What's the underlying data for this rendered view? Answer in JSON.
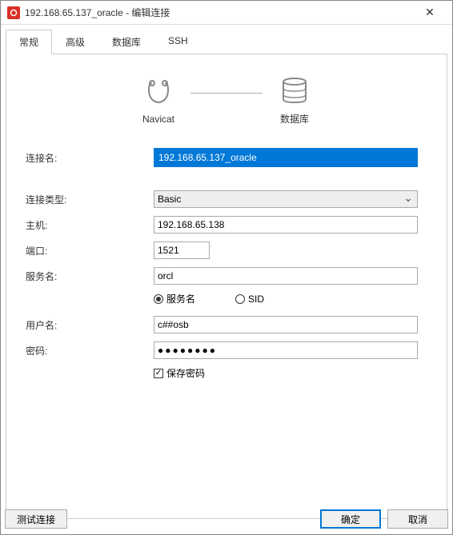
{
  "window": {
    "title": "192.168.65.137_oracle - 编辑连接"
  },
  "tabs": [
    {
      "label": "常规",
      "active": true
    },
    {
      "label": "高级",
      "active": false
    },
    {
      "label": "数据库",
      "active": false
    },
    {
      "label": "SSH",
      "active": false
    }
  ],
  "diagram": {
    "left_label": "Navicat",
    "right_label": "数据库"
  },
  "form": {
    "connection_name_label": "连接名:",
    "connection_name_value": "192.168.65.137_oracle",
    "connection_type_label": "连接类型:",
    "connection_type_value": "Basic",
    "host_label": "主机:",
    "host_value": "192.168.65.138",
    "port_label": "端口:",
    "port_value": "1521",
    "service_name_label": "服务名:",
    "service_name_value": "orcl",
    "radio_service": "服务名",
    "radio_sid": "SID",
    "username_label": "用户名:",
    "username_value": "c##osb",
    "password_label": "密码:",
    "password_value": "●●●●●●●●",
    "save_password_label": "保存密码"
  },
  "buttons": {
    "test": "测试连接",
    "ok": "确定",
    "cancel": "取消"
  }
}
